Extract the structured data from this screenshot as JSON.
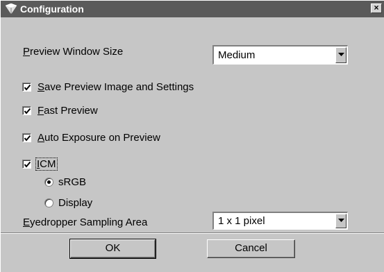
{
  "window": {
    "title": "Configuration",
    "close_label": "×",
    "icon": "app-icon"
  },
  "preview_size": {
    "label_mnemonic": "P",
    "label_rest": "review Window Size",
    "value": "Medium"
  },
  "options": {
    "save_preview": {
      "checked": true,
      "mnemonic": "S",
      "rest": "ave Preview Image and Settings"
    },
    "fast_preview": {
      "checked": true,
      "mnemonic": "F",
      "rest": "ast Preview"
    },
    "auto_exposure": {
      "checked": true,
      "mnemonic": "A",
      "rest": "uto Exposure on Preview"
    },
    "icm": {
      "checked": true,
      "mnemonic": "I",
      "rest": "CM"
    }
  },
  "icm_profiles": {
    "srgb": {
      "label": "sRGB",
      "selected": true
    },
    "display": {
      "label": "Display",
      "selected": false
    }
  },
  "eyedropper": {
    "label_mnemonic": "E",
    "label_rest": "yedropper Sampling Area",
    "value": "1 x 1 pixel"
  },
  "buttons": {
    "ok": "OK",
    "cancel": "Cancel"
  }
}
